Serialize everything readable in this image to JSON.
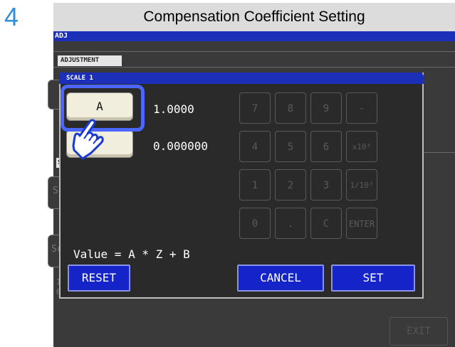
{
  "step_number": "4",
  "caption": "Compensation Coefficient Setting",
  "screen": {
    "mode_label": "ADJ",
    "tab_label": "ADJUSTMENT",
    "scale_tab": "SC",
    "bg_rows": [
      "1.",
      "0."
    ],
    "bg_button_chars": [
      "S",
      "S",
      "Sc"
    ],
    "exit_label": "EXIT"
  },
  "dialog": {
    "title": "SCALE 1",
    "coef_a": {
      "label": "A",
      "value": "1.0000"
    },
    "coef_b": {
      "label": "",
      "value": "0.000000"
    },
    "formula": "Value = A * Z + B",
    "keypad": [
      "7",
      "8",
      "9",
      "-",
      "4",
      "5",
      "6",
      "x10³",
      "1",
      "2",
      "3",
      "1/10³",
      "0",
      ".",
      "C",
      "ENTER"
    ],
    "reset_label": "RESET",
    "cancel_label": "CANCEL",
    "set_label": "SET"
  },
  "colors": {
    "title_bar": "#1c2fb8",
    "button_blue": "#1524c8",
    "step_number": "#2f8fd8",
    "highlight": "#4b67ff"
  },
  "icons": {
    "pointer": "pointing-hand-icon"
  }
}
